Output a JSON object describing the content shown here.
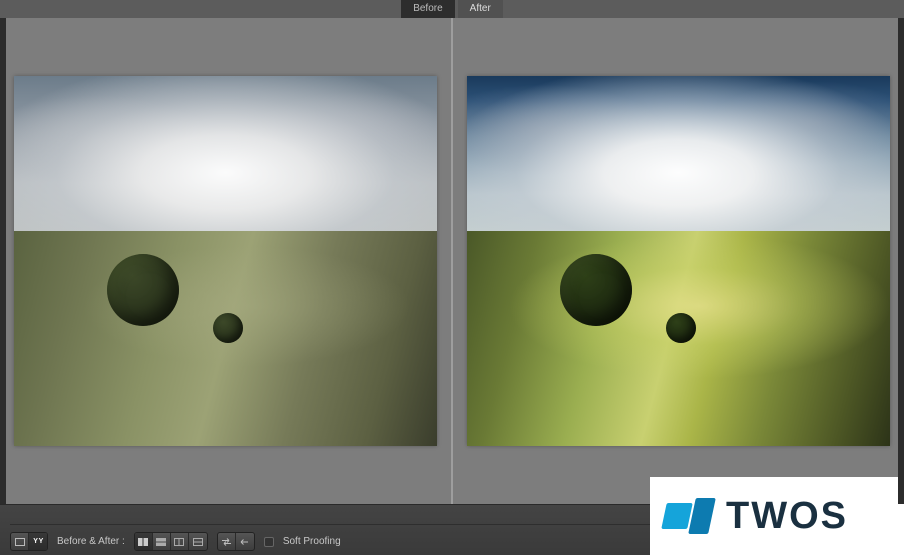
{
  "tabs": {
    "before": "Before",
    "after": "After"
  },
  "toolbar": {
    "mode_label": "Before & After :",
    "soft_proofing": "Soft Proofing",
    "view_buttons": {
      "loupe": "▭",
      "compare_yy": "Y|Y"
    },
    "layout_buttons": {
      "sbs": "⿰",
      "tb": "⿱",
      "split_v": "◧",
      "split_h": "⬒"
    }
  },
  "watermark": {
    "text": "TWOS"
  }
}
